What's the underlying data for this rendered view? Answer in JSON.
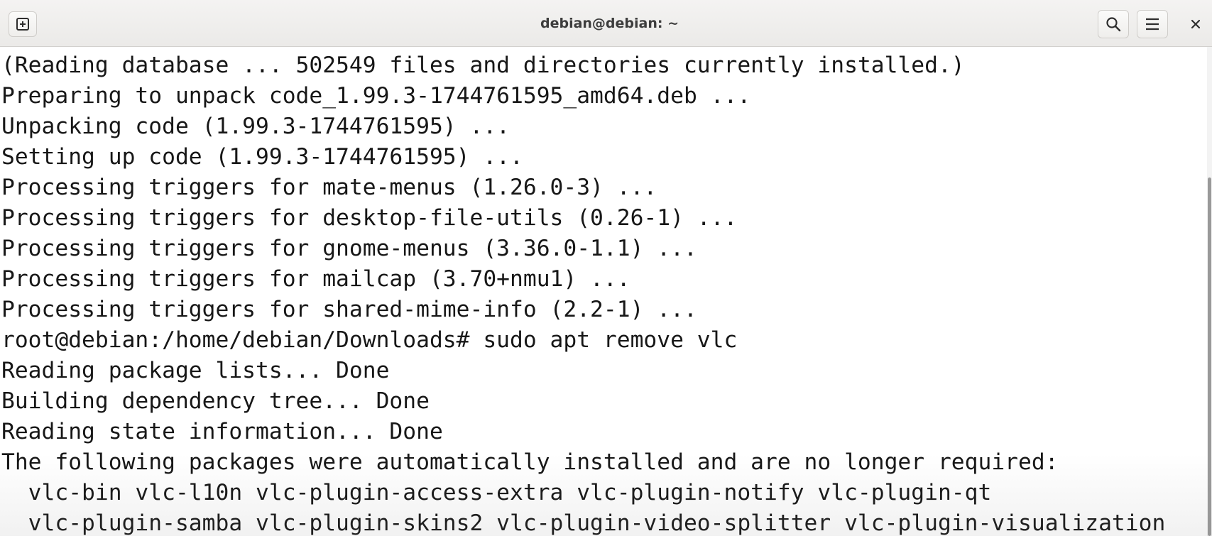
{
  "window": {
    "title": "debian@debian: ~"
  },
  "headerbar": {
    "new_tab_icon": "plus-square-icon",
    "search_icon": "search-icon",
    "menu_icon": "hamburger-menu-icon",
    "close_icon": "close-icon"
  },
  "terminal": {
    "lines": [
      "(Reading database ... 502549 files and directories currently installed.)",
      "Preparing to unpack code_1.99.3-1744761595_amd64.deb ...",
      "Unpacking code (1.99.3-1744761595) ...",
      "Setting up code (1.99.3-1744761595) ...",
      "Processing triggers for mate-menus (1.26.0-3) ...",
      "Processing triggers for desktop-file-utils (0.26-1) ...",
      "Processing triggers for gnome-menus (3.36.0-1.1) ...",
      "Processing triggers for mailcap (3.70+nmu1) ...",
      "Processing triggers for shared-mime-info (2.2-1) ...",
      "root@debian:/home/debian/Downloads# sudo apt remove vlc",
      "Reading package lists... Done",
      "Building dependency tree... Done",
      "Reading state information... Done",
      "The following packages were automatically installed and are no longer required:",
      "  vlc-bin vlc-l10n vlc-plugin-access-extra vlc-plugin-notify vlc-plugin-qt",
      "  vlc-plugin-samba vlc-plugin-skins2 vlc-plugin-video-splitter vlc-plugin-visualization"
    ]
  }
}
